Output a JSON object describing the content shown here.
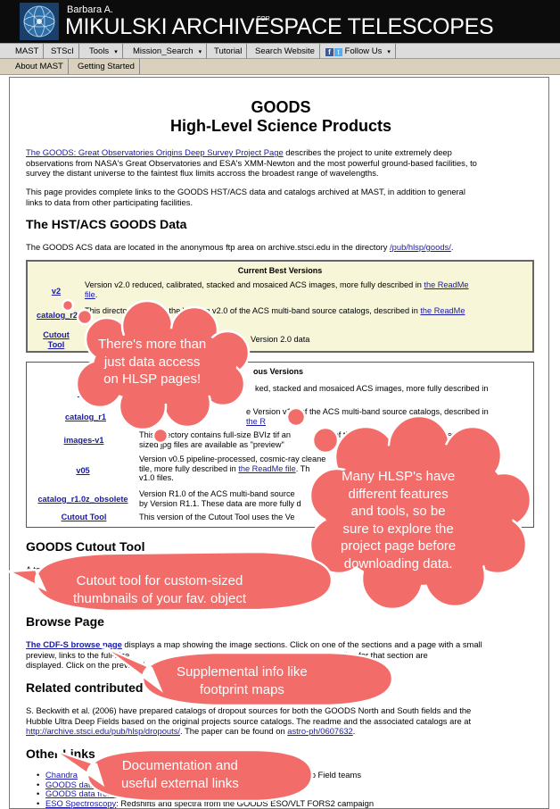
{
  "header": {
    "prefix": "Barbara A.",
    "name": "MIKULSKI ARCHIVE",
    "for": "FOR",
    "tail": "SPACE TELESCOPES"
  },
  "nav": {
    "primary": [
      "MAST",
      "STScI",
      "Tools",
      "Mission_Search",
      "Tutorial",
      "Search Website",
      "Follow Us"
    ],
    "caret": "▾",
    "secondary": [
      "About MAST",
      "Getting Started"
    ]
  },
  "page": {
    "title_line1": "GOODS",
    "title_line2": "High-Level Science Products",
    "intro_link": "The GOODS: Great Observatories Origins Deep Survey Project Page",
    "intro_text_1": " describes the project to unite extremely deep",
    "intro_text_2": "observations from NASA's Great Observatories and ESA's XMM-Newton and the most powerful ground-based facilities, to",
    "intro_text_3": "survey the distant universe to the faintest flux limits accross the broadest range of wavelengths.",
    "para2_1": "This page provides complete links to the GOODS HST/ACS data and catalogs archived at MAST, in addition to general",
    "para2_2": "links to data from other participating facilities.",
    "h_hst": "The HST/ACS GOODS Data",
    "hst_text": "The GOODS ACS data are located in the anonymous ftp area on archive.stsci.edu in the directory ",
    "hst_link": "/pub/hlsp/goods/",
    "hst_end": ".",
    "current": {
      "title": "Current Best Versions",
      "rows": [
        {
          "link": "v2",
          "desc_1": "Version v2.0 reduced, calibrated, stacked and mosaiced ACS images, more fully described in ",
          "desc_link": "the ReadMe",
          "desc_2": "file",
          "desc_end": "."
        },
        {
          "link": "catalog_r2",
          "desc_1": "This directory contains the Version v2.0 of the ACS multi-band source catalogs, described in ",
          "desc_link": "the ReadMe"
        },
        {
          "link_1": "Cutout",
          "link_2": "Tool",
          "desc_a": "Th",
          "desc_b": "Version 2.0 data"
        }
      ]
    },
    "previous": {
      "title_tail": "ous Versions",
      "rows": [
        {
          "link": "v1",
          "desc_1": "ked, stacked and mosaiced ACS images, more fully described in",
          "desc_2": ""
        },
        {
          "link": "catalog_r1",
          "desc_1": "e Version v1.0 of the ACS multi-band source catalogs, described in",
          "desc_link": "the R"
        },
        {
          "link": "images-v1",
          "desc_1": "This directory contains full-size BVIz tif an",
          "desc_1b": "of the",
          "desc_1c": "ion, two smaller",
          "desc_2": "sized jpg files are available as \"preview\""
        },
        {
          "link": "v05",
          "desc_1": "Version v0.5 pipeline-processed, cosmic-ray cleane",
          "desc_2a": "tile, more fully described in ",
          "desc_link": "the ReadMe file",
          "desc_2b": ". Th",
          "desc_3": "v1.0 files."
        },
        {
          "link": "catalog_r1.0z_obsolete",
          "desc_1": "Version R1.0 of the ACS multi-band source",
          "desc_1b": "eded",
          "desc_2": "by Version R1.1. These data are more fully d"
        },
        {
          "link": "Cutout Tool",
          "desc_1": "This version of the Cutout Tool uses the Ve"
        }
      ]
    },
    "h_cutout": "GOODS Cutout Tool",
    "cutout_text_a": "A too",
    "cutout_text_b": "images is a",
    "h_browse": "Browse Page",
    "browse_link": "The CDF-S browse page",
    "browse_1": " displays a map showing the image sections. Click on one of the sections and a page with a small",
    "browse_2a": "preview, links to the full-size",
    "browse_2b": "and weight map data files for that section are",
    "browse_3": "displayed. Click on the preview i",
    "h_related": "Related contributed",
    "related_1": "S. Beckwith et al. (2006) have prepared catalogs of dropout sources for both the GOODS North and South fields and the",
    "related_2": "Hubble Ultra Deep Fields based on the original projects source catalogs. The readme and the associated catalogs are at",
    "related_link1": "http://archive.stsci.edu/pub/hlsp/dropouts/",
    "related_3": ". The paper can be found on ",
    "related_link2": "astro-ph/0607632",
    "related_end": ".",
    "h_other": "Other Links",
    "other": [
      {
        "a": "Chandra",
        "b": "Chandra Deep Field teams"
      },
      {
        "a": "GOODS data",
        "b": ""
      },
      {
        "a": "GOODS data from XMM",
        "b": ""
      },
      {
        "a": "ESO Spectroscopy",
        "b": ": Redshifts and spectra from the GOODS ESO/VLT FORS2 campaign"
      }
    ]
  },
  "callouts": {
    "c1": [
      "There's more than",
      "just data access",
      "on HLSP pages!"
    ],
    "c2": [
      "Many HLSP's have",
      "different features",
      "and tools, so be",
      "sure to explore the",
      "project page before",
      "downloading data."
    ],
    "c3": [
      "Cutout tool for custom-sized",
      "thumbnails of your fav. object"
    ],
    "c4": [
      "Supplemental info like",
      "footprint maps"
    ],
    "c5": [
      "Documentation and",
      "useful external links"
    ],
    "fill": "#f26d6a",
    "stroke": "#ffffff"
  }
}
